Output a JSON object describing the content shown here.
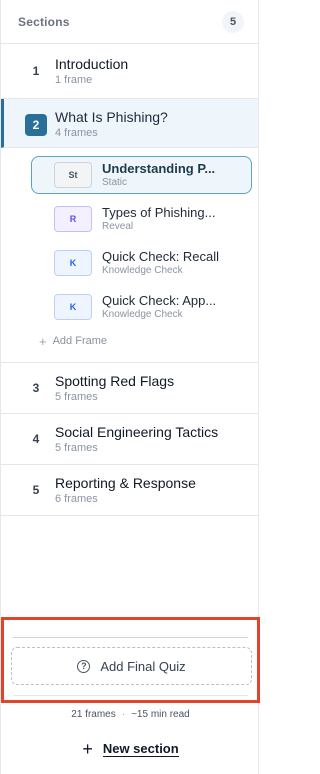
{
  "header": {
    "title": "Sections",
    "count": "5"
  },
  "sections": [
    {
      "num": "1",
      "name": "Introduction",
      "sub": "1 frame"
    },
    {
      "num": "2",
      "name": "What Is Phishing?",
      "sub": "4 frames"
    },
    {
      "num": "3",
      "name": "Spotting Red Flags",
      "sub": "5 frames"
    },
    {
      "num": "4",
      "name": "Social Engineering Tactics",
      "sub": "5 frames"
    },
    {
      "num": "5",
      "name": "Reporting & Response",
      "sub": "6 frames"
    }
  ],
  "frames": [
    {
      "badge": "St",
      "name": "Understanding P...",
      "type": "Static"
    },
    {
      "badge": "R",
      "name": "Types of Phishing...",
      "type": "Reveal"
    },
    {
      "badge": "K",
      "name": "Quick Check: Recall",
      "type": "Knowledge Check"
    },
    {
      "badge": "K",
      "name": "Quick Check: App...",
      "type": "Knowledge Check"
    }
  ],
  "add_frame_label": "Add Frame",
  "quiz": {
    "label": "Add Final Quiz",
    "icon": "?"
  },
  "stats": {
    "frames": "21 frames",
    "separator": "·",
    "read_time": "~15 min read"
  },
  "new_section": {
    "plus": "+",
    "label": "New section"
  }
}
